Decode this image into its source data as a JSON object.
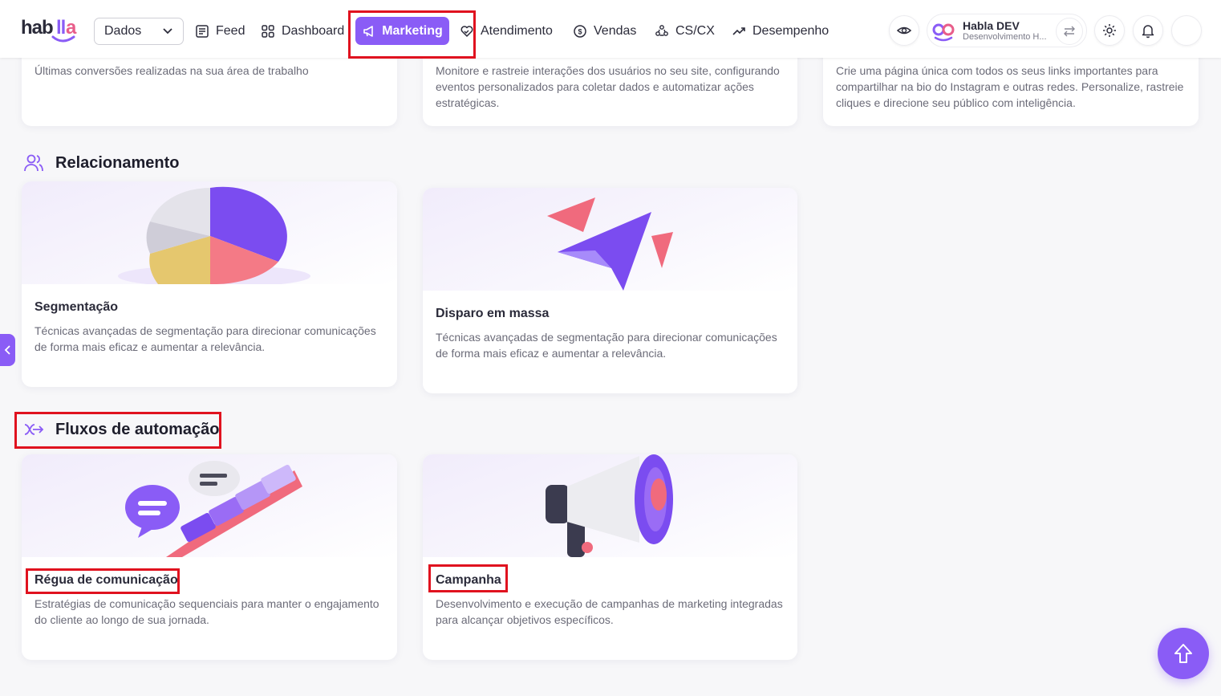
{
  "header": {
    "logo_text": "habla",
    "data_select": "Dados",
    "nav": {
      "feed": "Feed",
      "dashboard": "Dashboard",
      "marketing": "Marketing",
      "atendimento": "Atendimento",
      "vendas": "Vendas",
      "cscx": "CS/CX",
      "desempenho": "Desempenho"
    },
    "user": {
      "name": "Habla DEV",
      "subtitle": "Desenvolvimento H..."
    }
  },
  "top_cards": [
    {
      "desc": "Últimas conversões realizadas na sua área de trabalho"
    },
    {
      "desc": "Monitore e rastreie interações dos usuários no seu site, configurando eventos personalizados para coletar dados e automatizar ações estratégicas."
    },
    {
      "desc": "Crie uma página única com todos os seus links importantes para compartilhar na bio do Instagram e outras redes. Personalize, rastreie cliques e direcione seu público com inteligência."
    }
  ],
  "sections": {
    "relacionamento": "Relacionamento",
    "fluxos": "Fluxos de automação"
  },
  "cards": {
    "segmentacao": {
      "title": "Segmentação",
      "desc": "Técnicas avançadas de segmentação para direcionar comunicações de forma mais eficaz e aumentar a relevância."
    },
    "disparo": {
      "title": "Disparo em massa",
      "desc": "Técnicas avançadas de segmentação para direcionar comunicações de forma mais eficaz e aumentar a relevância."
    },
    "regua": {
      "title": "Régua de comunicação",
      "desc": "Estratégias de comunicação sequenciais para manter o engajamento do cliente ao longo de sua jornada."
    },
    "campanha": {
      "title": "Campanha",
      "desc": "Desenvolvimento e execução de campanhas de marketing integradas para alcançar objetivos específicos."
    }
  },
  "colors": {
    "accent": "#8a5cf6",
    "highlight": "#e0121f",
    "pink": "#f06a7d"
  }
}
